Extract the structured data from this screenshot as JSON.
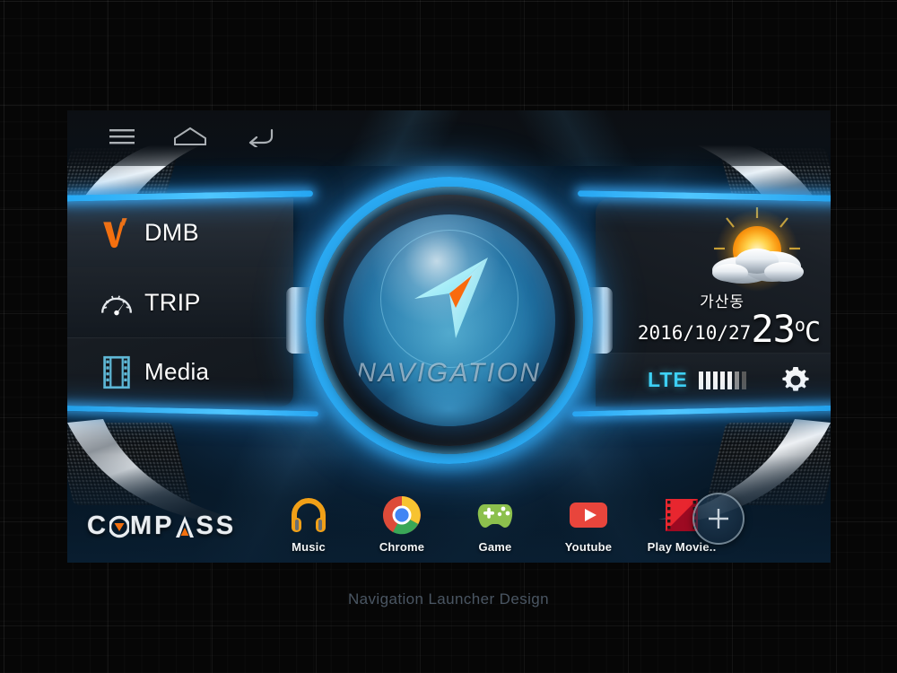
{
  "caption": "Navigation Launcher Design",
  "navbar": {
    "menu_icon": "hamburger-menu-icon",
    "home_icon": "home-icon",
    "back_icon": "back-icon"
  },
  "left_menu": {
    "items": [
      {
        "label": "DMB",
        "brand_mark": "V'",
        "icon": "dmb-logo-icon"
      },
      {
        "label": "TRIP",
        "icon": "speedometer-icon"
      },
      {
        "label": "Media",
        "icon": "film-strip-icon"
      }
    ]
  },
  "center": {
    "title": "NAVIGATION",
    "icon": "compass-arrow-icon"
  },
  "weather": {
    "icon": "sun-behind-cloud-icon",
    "city": "가산동",
    "date": "2016/10/27",
    "temperature": "23",
    "degree_symbol": "o",
    "unit": "C"
  },
  "status": {
    "network": "LTE",
    "signal_icon": "signal-bars-icon",
    "signal_bars_lit": 5,
    "signal_bars_total": 7,
    "settings_icon": "gear-icon"
  },
  "brand": {
    "name_part1": "C",
    "name_part2": "MP",
    "name_part3": "SS",
    "full": "COMPASS"
  },
  "dock": {
    "apps": [
      {
        "label": "Music",
        "icon": "headphones-icon"
      },
      {
        "label": "Chrome",
        "icon": "chrome-icon"
      },
      {
        "label": "Game",
        "icon": "gamepad-icon"
      },
      {
        "label": "Youtube",
        "icon": "youtube-icon"
      },
      {
        "label": "Play Movie..",
        "icon": "play-movies-icon"
      }
    ],
    "add_label": "+",
    "add_icon": "plus-icon"
  },
  "colors": {
    "neon_blue": "#2aa9f2",
    "accent_orange": "#f4700f",
    "lte_cyan": "#3ed1f5",
    "media_icon": "#5fb8d6"
  }
}
